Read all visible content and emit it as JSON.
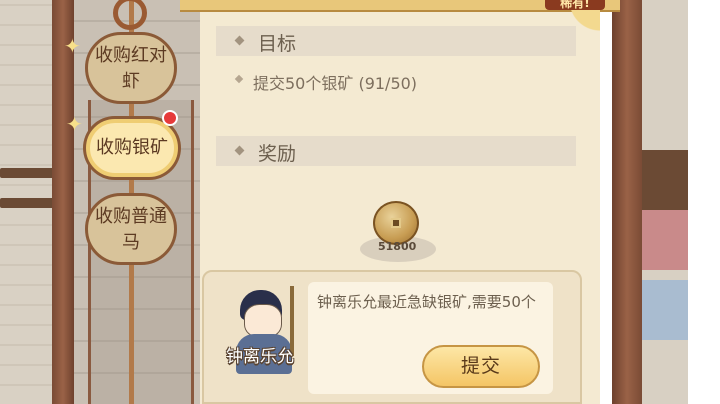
{
  "quest_tabs": [
    {
      "label": "收购红对虾",
      "line1": "收购红对",
      "line2": "虾"
    },
    {
      "label": "收购银矿",
      "line1": "收购银矿",
      "line2": ""
    },
    {
      "label": "收购普通马",
      "line1": "收购普通",
      "line2": "马"
    }
  ],
  "badge": {
    "text": "稀有!"
  },
  "goal": {
    "title": "目标",
    "item": "提交50个银矿 (91/50)"
  },
  "reward": {
    "title": "奖励",
    "coin_amount": "51800",
    "icon": "copper-coin-icon"
  },
  "npc": {
    "name": "钟离乐允",
    "dialog": "钟离乐允最近急缺银矿,需要50个"
  },
  "actions": {
    "submit_label": "提交"
  },
  "colors": {
    "parchment": "#f4ead2",
    "wood": "#8b5a37",
    "button_gold": "#f4c565",
    "notify_red": "#e63a3a"
  }
}
